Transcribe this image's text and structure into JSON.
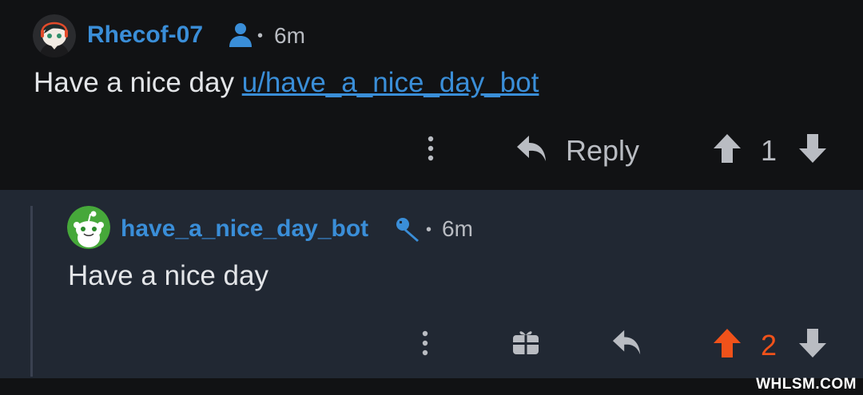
{
  "comments": [
    {
      "author": "Rhecof-07",
      "author_badge_icon": "user-icon",
      "separator": "•",
      "time": "6m",
      "body_text": "Have a nice day ",
      "body_link": "u/have_a_nice_day_bot",
      "actions": {
        "more_icon": "more-vertical-icon",
        "reply_icon": "reply-icon",
        "reply_label": "Reply",
        "upvote_icon": "arrow-up-icon",
        "score": "1",
        "downvote_icon": "arrow-down-icon"
      },
      "colors": {
        "score": "#b9bcc2",
        "upvote": "#b9bcc2"
      }
    },
    {
      "author": "have_a_nice_day_bot",
      "author_badge_icon": "microphone-icon",
      "separator": "•",
      "time": "6m",
      "body_text": "Have a nice day",
      "actions": {
        "more_icon": "more-vertical-icon",
        "award_icon": "gift-icon",
        "reply_icon": "reply-icon",
        "upvote_icon": "arrow-up-icon",
        "score": "2",
        "downvote_icon": "arrow-down-icon"
      },
      "colors": {
        "score": "#f0521a",
        "upvote": "#f0521a"
      }
    }
  ],
  "watermark": "WHLSM.COM",
  "theme": {
    "background": "#111214",
    "reply_background": "#212833",
    "username": "#3a8ed8",
    "muted": "#b9bcc2",
    "upvoted": "#f0521a"
  }
}
